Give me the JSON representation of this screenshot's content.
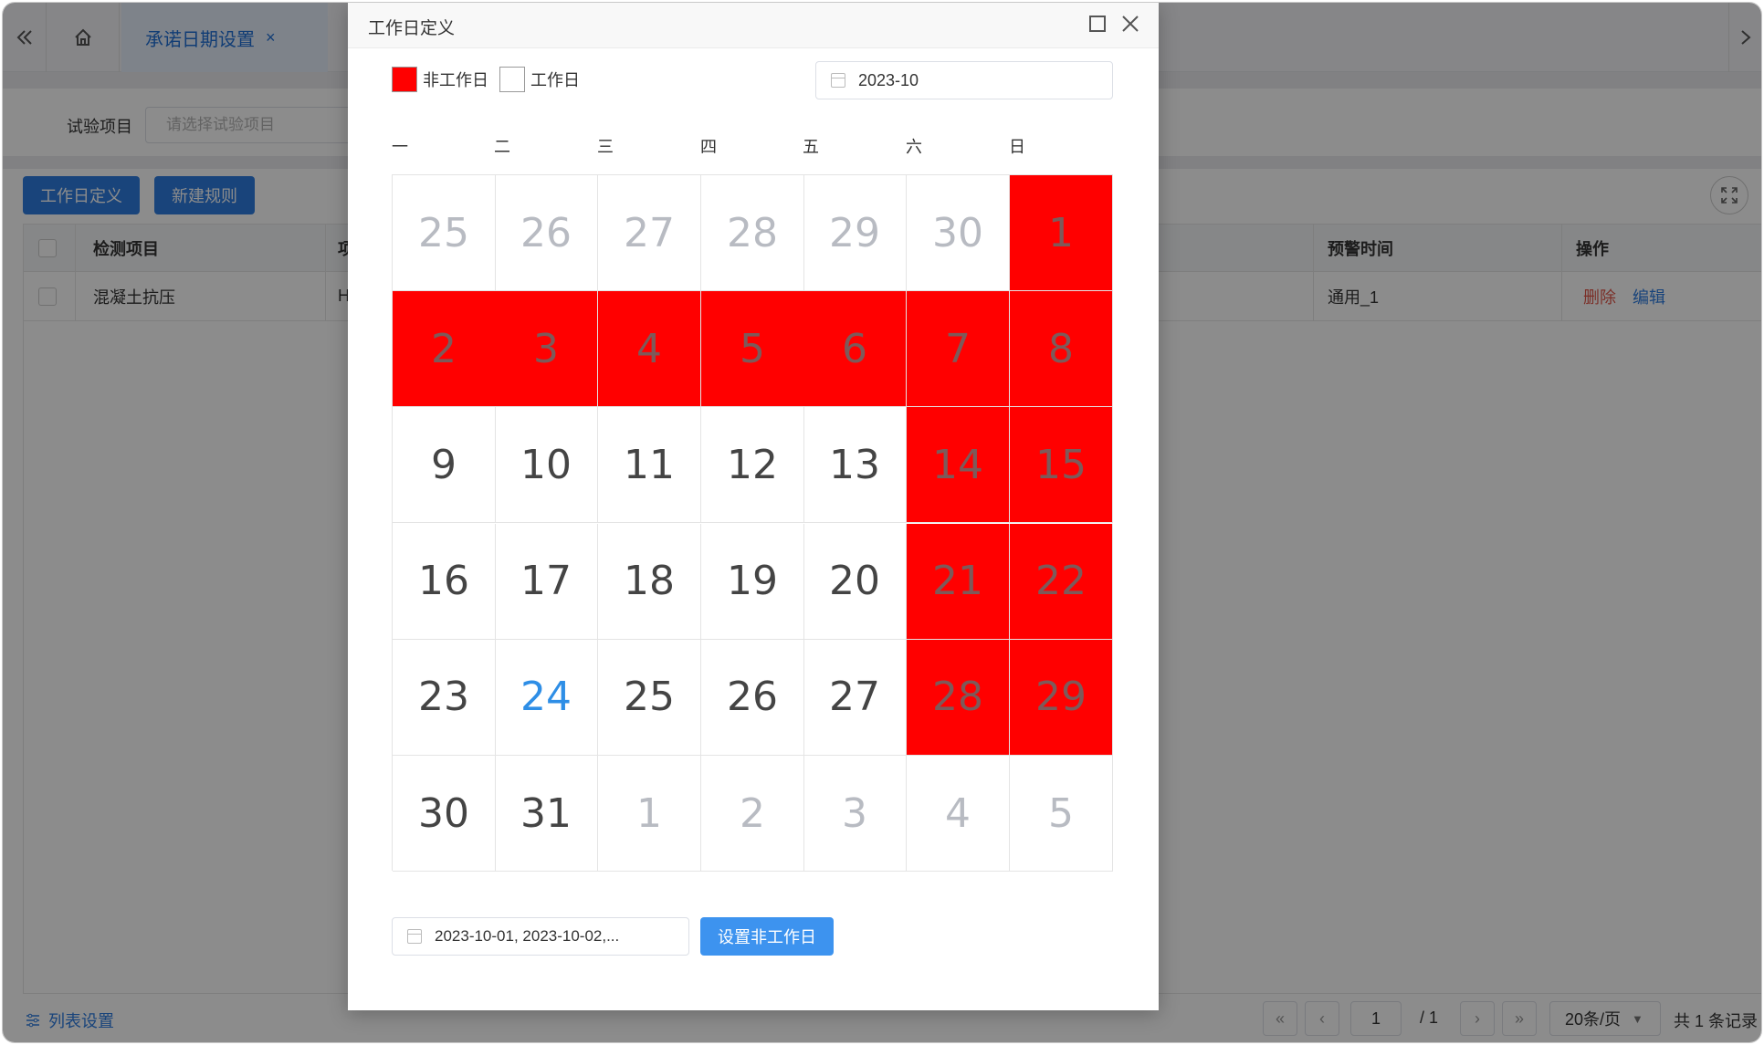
{
  "tabbar": {
    "active_tab": "承诺日期设置",
    "close_glyph": "×",
    "collapse_icon": "chevrons-left-icon",
    "home_icon": "home-icon"
  },
  "filter": {
    "label": "试验项目",
    "placeholder": "请选择试验项目"
  },
  "toolbar": {
    "workday_button": "工作日定义",
    "new_rule_button": "新建规则"
  },
  "table": {
    "columns": [
      "检测项目",
      "项",
      "预警时间",
      "操作"
    ],
    "rows": [
      {
        "item": "混凝土抗压",
        "col2": "H",
        "warn_time": "通用_1",
        "delete": "删除",
        "edit": "编辑"
      }
    ]
  },
  "footer": {
    "list_settings": "列表设置",
    "page_input": "1",
    "page_total": "/ 1",
    "page_size": "20条/页",
    "total": "共 1 条记录"
  },
  "dialog": {
    "title": "工作日定义",
    "legend_nonwork": "非工作日",
    "legend_work": "工作日",
    "month": "2023-10",
    "weekdays": [
      "一",
      "二",
      "三",
      "四",
      "五",
      "六",
      "日"
    ],
    "days": [
      {
        "n": "25",
        "t": "other"
      },
      {
        "n": "26",
        "t": "other"
      },
      {
        "n": "27",
        "t": "other"
      },
      {
        "n": "28",
        "t": "other"
      },
      {
        "n": "29",
        "t": "other"
      },
      {
        "n": "30",
        "t": "other"
      },
      {
        "n": "1",
        "t": "off"
      },
      {
        "n": "2",
        "t": "off"
      },
      {
        "n": "3",
        "t": "off"
      },
      {
        "n": "4",
        "t": "off"
      },
      {
        "n": "5",
        "t": "off"
      },
      {
        "n": "6",
        "t": "off"
      },
      {
        "n": "7",
        "t": "off"
      },
      {
        "n": "8",
        "t": "off"
      },
      {
        "n": "9",
        "t": "work"
      },
      {
        "n": "10",
        "t": "work"
      },
      {
        "n": "11",
        "t": "work"
      },
      {
        "n": "12",
        "t": "work"
      },
      {
        "n": "13",
        "t": "work"
      },
      {
        "n": "14",
        "t": "off"
      },
      {
        "n": "15",
        "t": "off"
      },
      {
        "n": "16",
        "t": "work"
      },
      {
        "n": "17",
        "t": "work"
      },
      {
        "n": "18",
        "t": "work"
      },
      {
        "n": "19",
        "t": "work"
      },
      {
        "n": "20",
        "t": "work"
      },
      {
        "n": "21",
        "t": "off"
      },
      {
        "n": "22",
        "t": "off"
      },
      {
        "n": "23",
        "t": "work"
      },
      {
        "n": "24",
        "t": "today"
      },
      {
        "n": "25",
        "t": "work"
      },
      {
        "n": "26",
        "t": "work"
      },
      {
        "n": "27",
        "t": "work"
      },
      {
        "n": "28",
        "t": "off"
      },
      {
        "n": "29",
        "t": "off"
      },
      {
        "n": "30",
        "t": "work"
      },
      {
        "n": "31",
        "t": "work"
      },
      {
        "n": "1",
        "t": "other"
      },
      {
        "n": "2",
        "t": "other"
      },
      {
        "n": "3",
        "t": "other"
      },
      {
        "n": "4",
        "t": "other"
      },
      {
        "n": "5",
        "t": "other"
      }
    ],
    "selected_dates": "2023-10-01, 2023-10-02,...",
    "set_button": "设置非工作日",
    "colors": {
      "nonwork": "#ff0000",
      "today": "#2e8ee6",
      "primary": "#3d93ef"
    }
  }
}
